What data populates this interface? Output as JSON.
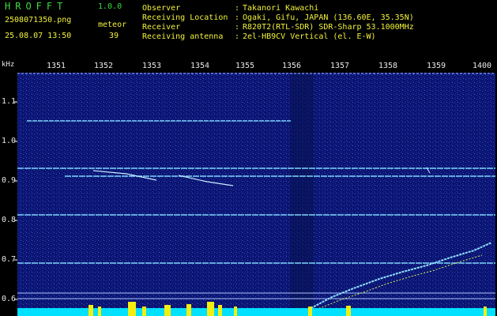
{
  "header": {
    "brand": "HROFFT",
    "version": "1.0.0",
    "filename": "2508071350.png",
    "meteor_label": "meteor",
    "datetime": "25.08.07 13:50",
    "meteor_count": "39"
  },
  "info": [
    {
      "label": "Observer",
      "colon": ":",
      "value": "Takanori Kawachi"
    },
    {
      "label": "Receiving Location",
      "colon": ":",
      "value": "Ogaki, Gifu, JAPAN (136.60E, 35.35N)"
    },
    {
      "label": "Receiver",
      "colon": ":",
      "value": "R820T2(RTL-SDR) SDR-Sharp 53.1000MHz"
    },
    {
      "label": "Receiving antenna",
      "colon": ":",
      "value": "2el-HB9CV Vertical (el. E-W)"
    }
  ],
  "axis": {
    "unit": "kHz",
    "x_ticks": [
      "1351",
      "1352",
      "1353",
      "1354",
      "1355",
      "1356",
      "1357",
      "1358",
      "1359",
      "1400"
    ],
    "y_ticks": [
      "1.1",
      "1.0",
      "0.9",
      "0.8",
      "0.7",
      "0.6"
    ]
  },
  "colors": {
    "background": "#000000",
    "spectrum_bg": "#0b1470",
    "trace": "#7fd8ff",
    "signal_bar": "#00e0ff",
    "burst": "#f4ee10",
    "header_green": "#3fdc3f",
    "header_yellow": "#f2f23a"
  }
}
